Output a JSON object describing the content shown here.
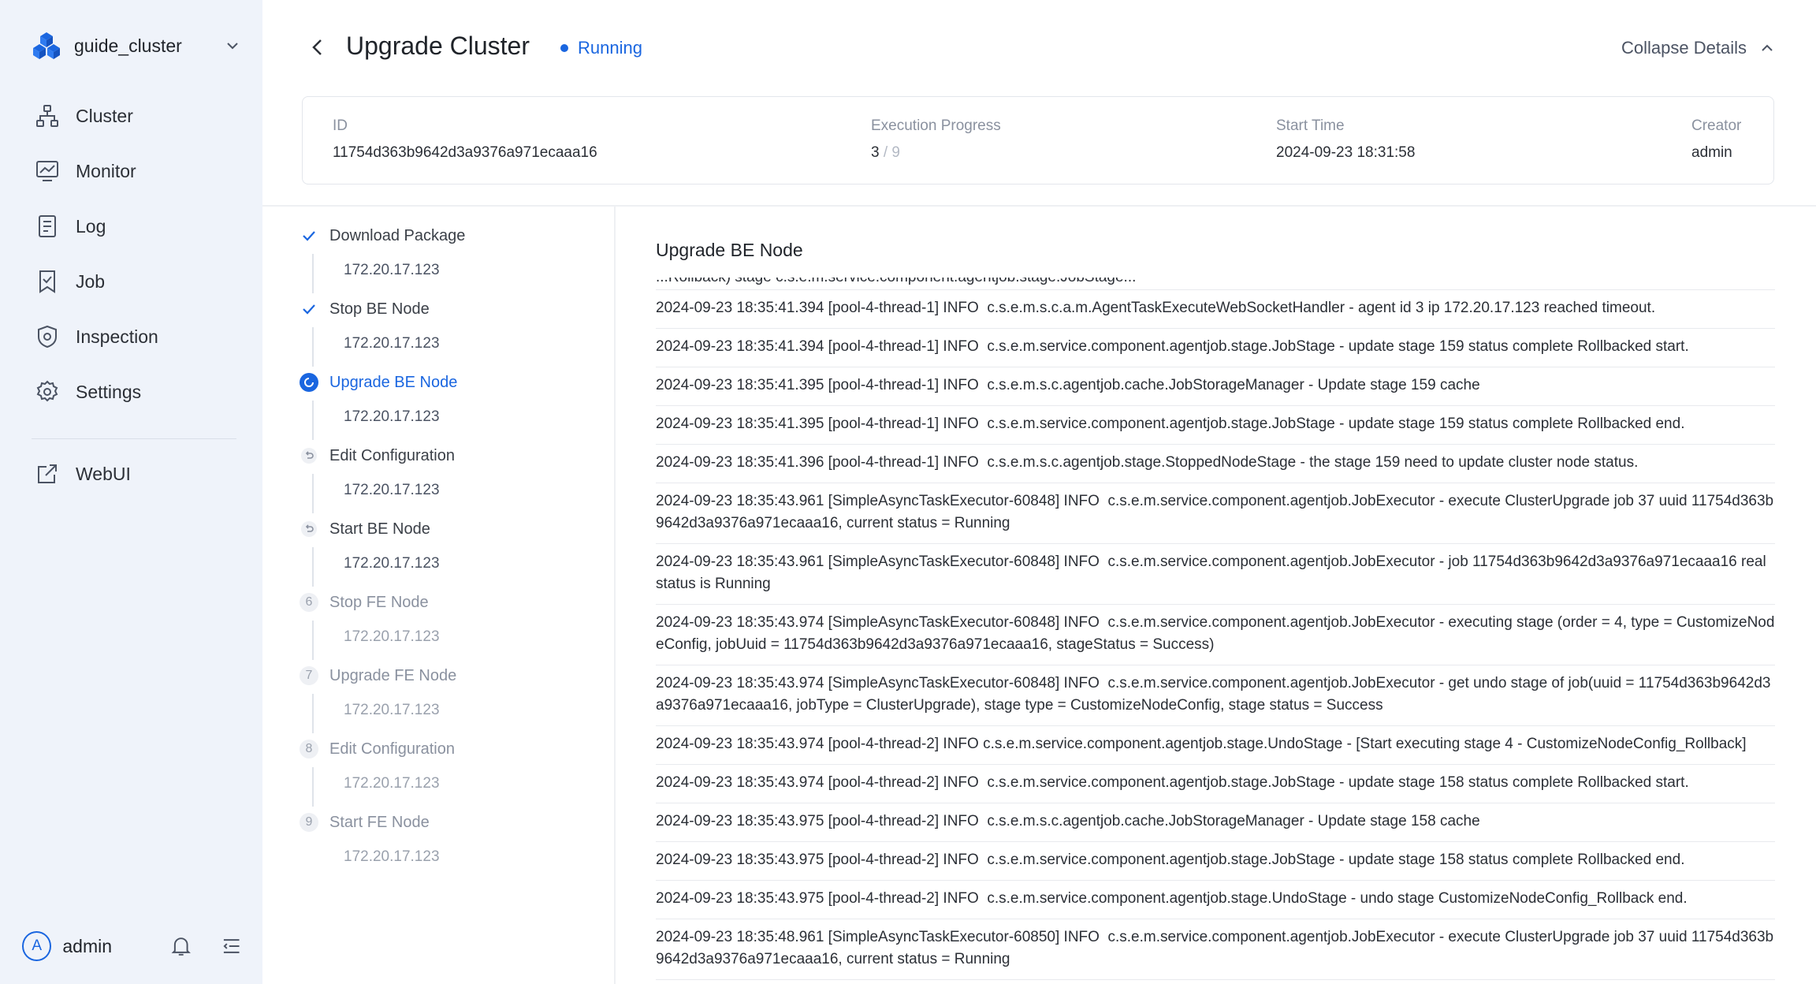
{
  "sidebar": {
    "cluster_name": "guide_cluster",
    "nav": [
      {
        "label": "Cluster",
        "icon": "cluster-icon"
      },
      {
        "label": "Monitor",
        "icon": "monitor-icon"
      },
      {
        "label": "Log",
        "icon": "log-icon"
      },
      {
        "label": "Job",
        "icon": "job-icon"
      },
      {
        "label": "Inspection",
        "icon": "inspection-icon"
      },
      {
        "label": "Settings",
        "icon": "settings-icon"
      }
    ],
    "webui": {
      "label": "WebUI",
      "icon": "external-link-icon"
    },
    "user": {
      "initial": "A",
      "name": "admin"
    }
  },
  "header": {
    "title": "Upgrade Cluster",
    "status": "Running",
    "collapse_label": "Collapse Details"
  },
  "info": {
    "id_label": "ID",
    "id_value": "11754d363b9642d3a9376a971ecaaa16",
    "progress_label": "Execution Progress",
    "progress_current": "3",
    "progress_total": "/ 9",
    "start_label": "Start Time",
    "start_value": "2024-09-23 18:31:58",
    "creator_label": "Creator",
    "creator_value": "admin"
  },
  "steps": [
    {
      "title": "Download Package",
      "state": "done",
      "node": "172.20.17.123"
    },
    {
      "title": "Stop BE Node",
      "state": "done",
      "node": "172.20.17.123"
    },
    {
      "title": "Upgrade BE Node",
      "state": "active",
      "node": "172.20.17.123"
    },
    {
      "title": "Edit Configuration",
      "state": "rollback",
      "node": "172.20.17.123"
    },
    {
      "title": "Start BE Node",
      "state": "rollback",
      "node": "172.20.17.123"
    },
    {
      "title": "Stop FE Node",
      "state": "pending",
      "number": "6",
      "node": "172.20.17.123"
    },
    {
      "title": "Upgrade FE Node",
      "state": "pending",
      "number": "7",
      "node": "172.20.17.123"
    },
    {
      "title": "Edit Configuration",
      "state": "pending",
      "number": "8",
      "node": "172.20.17.123"
    },
    {
      "title": "Start FE Node",
      "state": "pending",
      "number": "9",
      "node": "172.20.17.123"
    }
  ],
  "log": {
    "title": "Upgrade BE Node",
    "partial_line": "...Rollback) stage c.s.e.m.service.component.agentjob.stage.JobStage...",
    "entries": [
      "2024-09-23 18:35:41.394 [pool-4-thread-1] INFO  c.s.e.m.s.c.a.m.AgentTaskExecuteWebSocketHandler - agent id 3 ip 172.20.17.123 reached timeout.",
      "2024-09-23 18:35:41.394 [pool-4-thread-1] INFO  c.s.e.m.service.component.agentjob.stage.JobStage - update stage 159 status complete Rollbacked start.",
      "2024-09-23 18:35:41.395 [pool-4-thread-1] INFO  c.s.e.m.s.c.agentjob.cache.JobStorageManager - Update stage 159 cache",
      "2024-09-23 18:35:41.395 [pool-4-thread-1] INFO  c.s.e.m.service.component.agentjob.stage.JobStage - update stage 159 status complete Rollbacked end.",
      "2024-09-23 18:35:41.396 [pool-4-thread-1] INFO  c.s.e.m.s.c.agentjob.stage.StoppedNodeStage - the stage 159 need to update cluster node status.",
      "2024-09-23 18:35:43.961 [SimpleAsyncTaskExecutor-60848] INFO  c.s.e.m.service.component.agentjob.JobExecutor - execute ClusterUpgrade job 37 uuid 11754d363b9642d3a9376a971ecaaa16, current status = Running",
      "2024-09-23 18:35:43.961 [SimpleAsyncTaskExecutor-60848] INFO  c.s.e.m.service.component.agentjob.JobExecutor - job 11754d363b9642d3a9376a971ecaaa16 real status is Running",
      "2024-09-23 18:35:43.974 [SimpleAsyncTaskExecutor-60848] INFO  c.s.e.m.service.component.agentjob.JobExecutor - executing stage (order = 4, type = CustomizeNodeConfig, jobUuid = 11754d363b9642d3a9376a971ecaaa16, stageStatus = Success)",
      "2024-09-23 18:35:43.974 [SimpleAsyncTaskExecutor-60848] INFO  c.s.e.m.service.component.agentjob.JobExecutor - get undo stage of job(uuid = 11754d363b9642d3a9376a971ecaaa16, jobType = ClusterUpgrade), stage type = CustomizeNodeConfig, stage status = Success",
      "2024-09-23 18:35:43.974 [pool-4-thread-2] INFO c.s.e.m.service.component.agentjob.stage.UndoStage - [Start executing stage 4 - CustomizeNodeConfig_Rollback]",
      "2024-09-23 18:35:43.974 [pool-4-thread-2] INFO  c.s.e.m.service.component.agentjob.stage.JobStage - update stage 158 status complete Rollbacked start.",
      "2024-09-23 18:35:43.975 [pool-4-thread-2] INFO  c.s.e.m.s.c.agentjob.cache.JobStorageManager - Update stage 158 cache",
      "2024-09-23 18:35:43.975 [pool-4-thread-2] INFO  c.s.e.m.service.component.agentjob.stage.JobStage - update stage 158 status complete Rollbacked end.",
      "2024-09-23 18:35:43.975 [pool-4-thread-2] INFO  c.s.e.m.service.component.agentjob.stage.UndoStage - undo stage CustomizeNodeConfig_Rollback end.",
      "2024-09-23 18:35:48.961 [SimpleAsyncTaskExecutor-60850] INFO  c.s.e.m.service.component.agentjob.JobExecutor - execute ClusterUpgrade job 37 uuid 11754d363b9642d3a9376a971ecaaa16, current status = Running"
    ]
  },
  "colors": {
    "accent": "#1a66e0",
    "sidebar_bg": "#eff3fa"
  }
}
